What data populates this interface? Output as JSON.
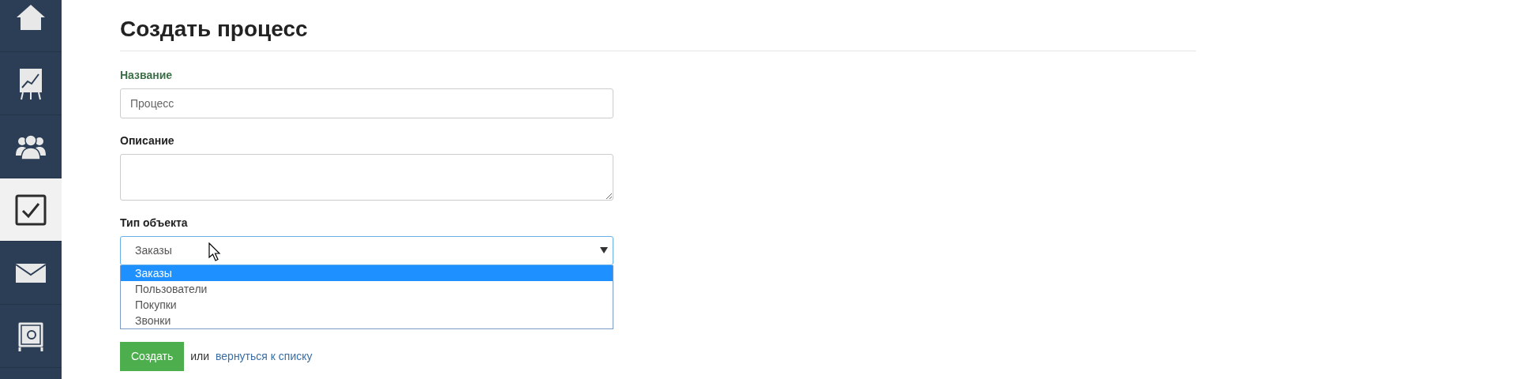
{
  "sidebar": {
    "items": [
      {
        "kind": "home",
        "selected": false
      },
      {
        "kind": "chart",
        "selected": false
      },
      {
        "kind": "users",
        "selected": false
      },
      {
        "kind": "tasks",
        "selected": true
      },
      {
        "kind": "mail",
        "selected": false
      },
      {
        "kind": "safe",
        "selected": false
      }
    ]
  },
  "page": {
    "title": "Создать процесс"
  },
  "form": {
    "name": {
      "label": "Название",
      "value": "Процесс"
    },
    "description": {
      "label": "Описание"
    },
    "object_type": {
      "label": "Тип объекта",
      "value": "Заказы",
      "expanded": true,
      "options": [
        {
          "label": "Заказы",
          "selected": true
        },
        {
          "label": "Пользователи",
          "selected": false
        },
        {
          "label": "Покупки",
          "selected": false
        },
        {
          "label": "Звонки",
          "selected": false
        }
      ]
    },
    "submit": "Создать",
    "or_text": "или",
    "back_link": "вернуться к списку"
  }
}
